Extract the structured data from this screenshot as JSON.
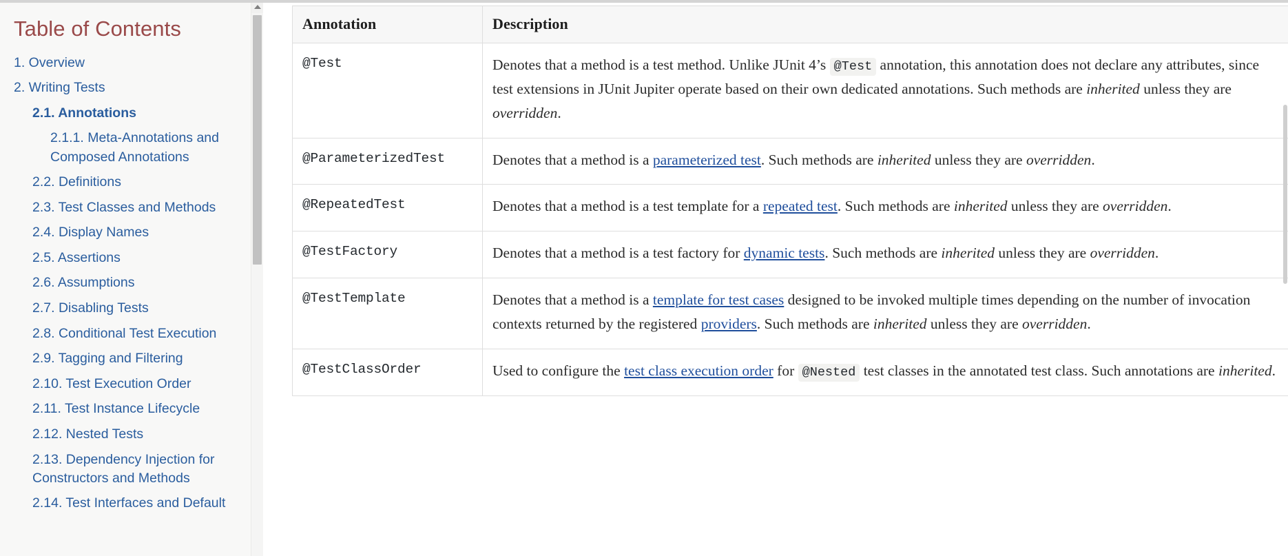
{
  "sidebar": {
    "title": "Table of Contents",
    "scrollbar": {
      "up_arrow": "scroll-up"
    },
    "items": [
      {
        "label": "1. Overview",
        "level": 1,
        "active": false
      },
      {
        "label": "2. Writing Tests",
        "level": 1,
        "active": false
      },
      {
        "label": "2.1. Annotations",
        "level": 2,
        "active": true
      },
      {
        "label": "2.1.1. Meta-Annotations and Composed Annotations",
        "level": 3,
        "active": false
      },
      {
        "label": "2.2. Definitions",
        "level": 2,
        "active": false
      },
      {
        "label": "2.3. Test Classes and Methods",
        "level": 2,
        "active": false
      },
      {
        "label": "2.4. Display Names",
        "level": 2,
        "active": false
      },
      {
        "label": "2.5. Assertions",
        "level": 2,
        "active": false
      },
      {
        "label": "2.6. Assumptions",
        "level": 2,
        "active": false
      },
      {
        "label": "2.7. Disabling Tests",
        "level": 2,
        "active": false
      },
      {
        "label": "2.8. Conditional Test Execution",
        "level": 2,
        "active": false
      },
      {
        "label": "2.9. Tagging and Filtering",
        "level": 2,
        "active": false
      },
      {
        "label": "2.10. Test Execution Order",
        "level": 2,
        "active": false
      },
      {
        "label": "2.11. Test Instance Lifecycle",
        "level": 2,
        "active": false
      },
      {
        "label": "2.12. Nested Tests",
        "level": 2,
        "active": false
      },
      {
        "label": "2.13. Dependency Injection for Constructors and Methods",
        "level": 2,
        "active": false
      },
      {
        "label": "2.14. Test Interfaces and Default",
        "level": 2,
        "active": false
      }
    ]
  },
  "table": {
    "headers": {
      "annotation": "Annotation",
      "description": "Description"
    },
    "rows": [
      {
        "annotation": "@Test",
        "description_parts": [
          {
            "t": "text",
            "v": "Denotes that a method is a test method. Unlike JUnit 4’s "
          },
          {
            "t": "code",
            "v": "@Test"
          },
          {
            "t": "text",
            "v": " annotation, this annotation does not declare any attributes, since test extensions in JUnit Jupiter operate based on their own dedicated annotations. Such methods are "
          },
          {
            "t": "em",
            "v": "inherited"
          },
          {
            "t": "text",
            "v": " unless they are "
          },
          {
            "t": "em",
            "v": "overridden"
          },
          {
            "t": "text",
            "v": "."
          }
        ]
      },
      {
        "annotation": "@ParameterizedTest",
        "description_parts": [
          {
            "t": "text",
            "v": "Denotes that a method is a "
          },
          {
            "t": "link",
            "v": "parameterized test"
          },
          {
            "t": "text",
            "v": ". Such methods are "
          },
          {
            "t": "em",
            "v": "inherited"
          },
          {
            "t": "text",
            "v": " unless they are "
          },
          {
            "t": "em",
            "v": "overridden"
          },
          {
            "t": "text",
            "v": "."
          }
        ]
      },
      {
        "annotation": "@RepeatedTest",
        "description_parts": [
          {
            "t": "text",
            "v": "Denotes that a method is a test template for a "
          },
          {
            "t": "link",
            "v": "repeated test"
          },
          {
            "t": "text",
            "v": ". Such methods are "
          },
          {
            "t": "em",
            "v": "inherited"
          },
          {
            "t": "text",
            "v": " unless they are "
          },
          {
            "t": "em",
            "v": "overridden"
          },
          {
            "t": "text",
            "v": "."
          }
        ]
      },
      {
        "annotation": "@TestFactory",
        "description_parts": [
          {
            "t": "text",
            "v": "Denotes that a method is a test factory for "
          },
          {
            "t": "link",
            "v": "dynamic tests"
          },
          {
            "t": "text",
            "v": ". Such methods are "
          },
          {
            "t": "em",
            "v": "inherited"
          },
          {
            "t": "text",
            "v": " unless they are "
          },
          {
            "t": "em",
            "v": "overridden"
          },
          {
            "t": "text",
            "v": "."
          }
        ]
      },
      {
        "annotation": "@TestTemplate",
        "description_parts": [
          {
            "t": "text",
            "v": "Denotes that a method is a "
          },
          {
            "t": "link",
            "v": "template for test cases"
          },
          {
            "t": "text",
            "v": " designed to be invoked multiple times depending on the number of invocation contexts returned by the registered "
          },
          {
            "t": "link",
            "v": "providers"
          },
          {
            "t": "text",
            "v": ". Such methods are "
          },
          {
            "t": "em",
            "v": "inherited"
          },
          {
            "t": "text",
            "v": " unless they are "
          },
          {
            "t": "em",
            "v": "overridden"
          },
          {
            "t": "text",
            "v": "."
          }
        ]
      },
      {
        "annotation": "@TestClassOrder",
        "description_parts": [
          {
            "t": "text",
            "v": "Used to configure the "
          },
          {
            "t": "link",
            "v": "test class execution order"
          },
          {
            "t": "text",
            "v": " for "
          },
          {
            "t": "code",
            "v": "@Nested"
          },
          {
            "t": "text",
            "v": " test classes in the annotated test class. Such annotations are "
          },
          {
            "t": "em",
            "v": "inherited"
          },
          {
            "t": "text",
            "v": "."
          }
        ]
      }
    ]
  },
  "colors": {
    "toc_title": "#9a4a4a",
    "toc_link": "#2a5d9e",
    "link": "#1f4e9c",
    "border": "#dedede",
    "header_bg": "#f7f7f7",
    "sidebar_bg": "#f8f8f7",
    "code_bg": "#f2f2f0"
  }
}
